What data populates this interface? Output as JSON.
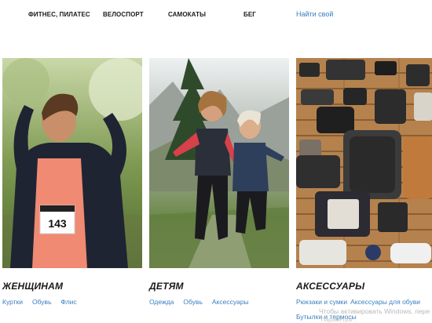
{
  "nav": {
    "items": [
      "ФИТНЕС, ПИЛАТЕС",
      "ВЕЛОСПОРТ",
      "САМОКАТЫ",
      "БЕГ"
    ],
    "find_link": "Найти свой"
  },
  "categories": [
    {
      "title": "ЖЕНЩИНАМ",
      "links": [
        "Куртки",
        "Обувь",
        "Флис"
      ],
      "photo_icon": "woman-runner-photo"
    },
    {
      "title": "ДЕТЯМ",
      "links": [
        "Одежда",
        "Обувь",
        "Аксессуары"
      ],
      "photo_icon": "kids-running-photo"
    },
    {
      "title": "АКСЕССУАРЫ",
      "links_row1": [
        "Рюкзаки и сумки",
        "Аксессуары для обуви"
      ],
      "links_row2": [
        "Бутылки и термосы"
      ],
      "photo_icon": "gear-flatlay-photo"
    }
  ],
  "race_bib_number": "143",
  "watermark": {
    "line1": "Чтобы активировать Windows, пере",
    "line2": "\"Параметры\"."
  },
  "colors": {
    "link": "#3a7fc1",
    "title": "#1a1a1a"
  }
}
